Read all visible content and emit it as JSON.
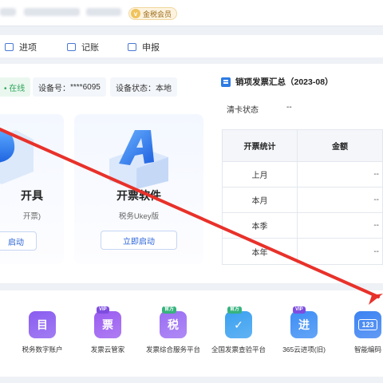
{
  "header": {
    "vip_icon": "v",
    "vip_label": "金税会员"
  },
  "nav": [
    {
      "label": "进项",
      "icon": "inbox-icon"
    },
    {
      "label": "记账",
      "icon": "ledger-icon"
    },
    {
      "label": "申报",
      "icon": "report-icon"
    }
  ],
  "status": {
    "online": "• 在线",
    "device_label": "设备号：",
    "device_value": "****6095",
    "state_label": "设备状态：",
    "state_value": "本地"
  },
  "cards": {
    "left": {
      "title": "开具",
      "subtitle": "开票)",
      "button": "启动"
    },
    "right": {
      "title": "开票软件",
      "subtitle": "税务Ukey版",
      "button": "立即启动"
    }
  },
  "summary": {
    "title": "销项发票汇总（2023-08）",
    "clear_label": "清卡状态",
    "clear_value": "--",
    "columns": [
      "开票统计",
      "金额"
    ],
    "rows": [
      {
        "label": "上月",
        "value": "--"
      },
      {
        "label": "本月",
        "value": "--"
      },
      {
        "label": "本季",
        "value": "--"
      },
      {
        "label": "本年",
        "value": "--"
      }
    ]
  },
  "tools": [
    {
      "label": "税务数字账户",
      "glyph": "目",
      "tag": "",
      "color": "#8a5cf0"
    },
    {
      "label": "发票云管家",
      "glyph": "票",
      "tag": "VIP",
      "color": "#9a5cf0"
    },
    {
      "label": "发票综合服务平台",
      "glyph": "税",
      "tag": "官方",
      "color": "#9b6df3"
    },
    {
      "label": "全国发票查验平台",
      "glyph": "✓",
      "tag": "官方",
      "color": "#3aa0f0"
    },
    {
      "label": "365云进项(旧)",
      "glyph": "进",
      "tag": "VIP",
      "color": "#3d8ef5"
    },
    {
      "label": "智能编码",
      "glyph": "123",
      "tag": "",
      "color": "#3b82f2"
    }
  ],
  "colors": {
    "accent": "#2a63d8",
    "online": "#2fa55a",
    "annotation_arrow": "#e8312a"
  }
}
